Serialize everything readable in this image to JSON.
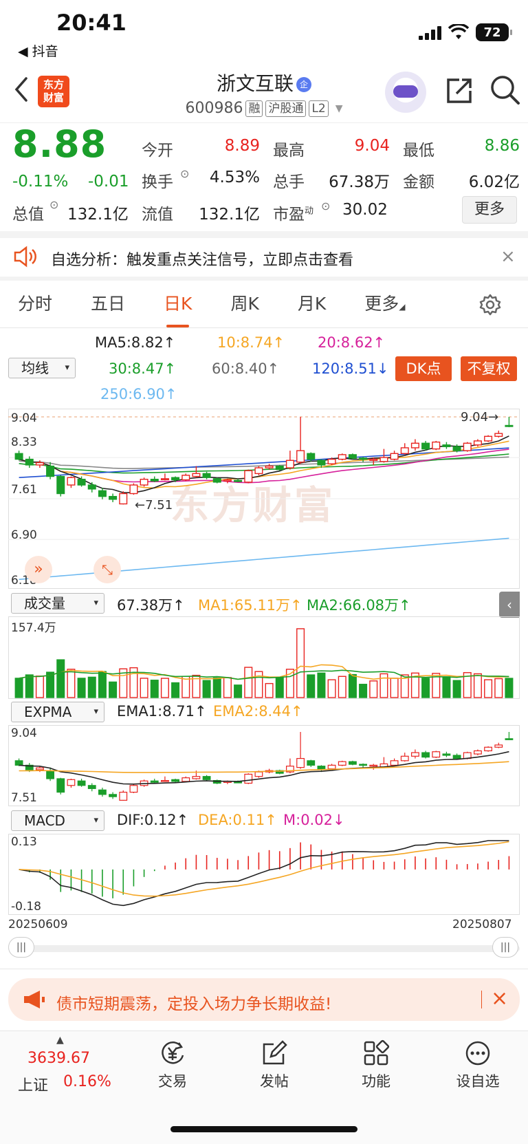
{
  "status_bar": {
    "time": "20:41",
    "back_app": "◀ 抖音",
    "battery": "72"
  },
  "header": {
    "logo_text": "东方\n财富",
    "stock_name": "浙文互联",
    "name_badge": "企",
    "stock_code": "600986",
    "tags": [
      "融",
      "沪股通",
      "L2"
    ]
  },
  "quote": {
    "price": "8.88",
    "change_pct": "-0.11%",
    "change_amt": "-0.01",
    "open_label": "今开",
    "open": "8.89",
    "high_label": "最高",
    "high": "9.04",
    "low_label": "最低",
    "low": "8.86",
    "turnover_label": "换手",
    "turnover": "4.53%",
    "volume_label": "总手",
    "volume": "67.38万",
    "amount_label": "金额",
    "amount": "6.02亿",
    "total_cap_label": "总值",
    "total_cap": "132.1亿",
    "float_cap_label": "流值",
    "float_cap": "132.1亿",
    "pe_label": "市盈",
    "pe_sup": "动",
    "pe": "30.02",
    "more_label": "更多"
  },
  "notice": {
    "text": "自选分析：触发重点关注信号，立即点击查看"
  },
  "tabs": [
    "分时",
    "五日",
    "日K",
    "周K",
    "月K",
    "更多"
  ],
  "active_tab": "日K",
  "kline": {
    "ma_selector": "均线",
    "ma5": "MA5:8.82↑",
    "ma10": "10:8.74↑",
    "ma20": "20:8.62↑",
    "ma30": "30:8.47↑",
    "ma60": "60:8.40↑",
    "ma120": "120:8.51↓",
    "ma250": "250:6.90↑",
    "dk_button": "DK点",
    "fq_button": "不复权",
    "y_labels": [
      "9.04",
      "8.33",
      "7.61",
      "6.90",
      "6.18"
    ],
    "max_marker": "9.04→",
    "min_marker": "←7.51",
    "watermark": "东方财富",
    "colors": {
      "up": "#e8231f",
      "down": "#1a9e2a",
      "ma5": "#222222",
      "ma10": "#f5a623",
      "ma20": "#d6219b",
      "ma30": "#1a9e2a",
      "ma60": "#888888",
      "ma120": "#1f4fd1",
      "ma250": "#6cb8f0"
    }
  },
  "volume": {
    "selector": "成交量",
    "value": "67.38万↑",
    "ma1": "MA1:65.11万↑",
    "ma2": "MA2:66.08万↑",
    "y_max": "157.4万"
  },
  "expma": {
    "selector": "EXPMA",
    "ema1": "EMA1:8.71↑",
    "ema2": "EMA2:8.44↑",
    "y_labels": [
      "9.04",
      "7.51"
    ]
  },
  "macd": {
    "selector": "MACD",
    "dif": "DIF:0.12↑",
    "dea": "DEA:0.11↑",
    "m": "M:0.02↓",
    "y_labels": [
      "0.13",
      "-0.18"
    ]
  },
  "date_range": {
    "start": "20250609",
    "end": "20250807"
  },
  "banner": {
    "text": "债市短期震荡，定投入场力争长期收益!"
  },
  "bottom_nav": {
    "index_value": "3639.67",
    "index_name": "上证",
    "index_change": "0.16%",
    "items": [
      "交易",
      "发帖",
      "功能",
      "设自选"
    ]
  },
  "chart_data": {
    "type": "candlestick",
    "title": "",
    "ylim": [
      6.18,
      9.04
    ],
    "candles": [
      {
        "o": 8.4,
        "c": 8.3,
        "h": 8.45,
        "l": 8.28
      },
      {
        "o": 8.3,
        "c": 8.2,
        "h": 8.35,
        "l": 8.15
      },
      {
        "o": 8.2,
        "c": 8.24,
        "h": 8.28,
        "l": 8.15
      },
      {
        "o": 8.18,
        "c": 8.0,
        "h": 8.25,
        "l": 7.95
      },
      {
        "o": 8.0,
        "c": 7.7,
        "h": 8.02,
        "l": 7.65
      },
      {
        "o": 7.85,
        "c": 7.98,
        "h": 8.0,
        "l": 7.8
      },
      {
        "o": 7.95,
        "c": 7.85,
        "h": 8.0,
        "l": 7.82
      },
      {
        "o": 7.85,
        "c": 7.78,
        "h": 7.9,
        "l": 7.72
      },
      {
        "o": 7.75,
        "c": 7.65,
        "h": 7.8,
        "l": 7.6
      },
      {
        "o": 7.65,
        "c": 7.6,
        "h": 7.7,
        "l": 7.55
      },
      {
        "o": 7.52,
        "c": 7.7,
        "h": 7.74,
        "l": 7.51
      },
      {
        "o": 7.7,
        "c": 7.85,
        "h": 7.88,
        "l": 7.68
      },
      {
        "o": 7.85,
        "c": 7.95,
        "h": 7.98,
        "l": 7.82
      },
      {
        "o": 7.95,
        "c": 7.92,
        "h": 8.0,
        "l": 7.9
      },
      {
        "o": 7.95,
        "c": 7.96,
        "h": 8.05,
        "l": 7.93
      },
      {
        "o": 7.98,
        "c": 7.94,
        "h": 8.0,
        "l": 7.9
      },
      {
        "o": 7.94,
        "c": 8.02,
        "h": 8.05,
        "l": 7.92
      },
      {
        "o": 8.0,
        "c": 8.05,
        "h": 8.18,
        "l": 7.98
      },
      {
        "o": 8.05,
        "c": 7.98,
        "h": 8.08,
        "l": 7.95
      },
      {
        "o": 7.96,
        "c": 7.9,
        "h": 7.98,
        "l": 7.88
      },
      {
        "o": 7.92,
        "c": 7.94,
        "h": 7.96,
        "l": 7.88
      },
      {
        "o": 7.93,
        "c": 7.92,
        "h": 7.96,
        "l": 7.9
      },
      {
        "o": 7.9,
        "c": 8.1,
        "h": 8.12,
        "l": 7.88
      },
      {
        "o": 8.05,
        "c": 8.15,
        "h": 8.18,
        "l": 8.02
      },
      {
        "o": 8.15,
        "c": 8.18,
        "h": 8.22,
        "l": 8.12
      },
      {
        "o": 8.18,
        "c": 8.12,
        "h": 8.2,
        "l": 8.1
      },
      {
        "o": 8.15,
        "c": 8.28,
        "h": 8.45,
        "l": 8.12
      },
      {
        "o": 8.25,
        "c": 8.45,
        "h": 9.04,
        "l": 8.22
      },
      {
        "o": 8.4,
        "c": 8.3,
        "h": 8.42,
        "l": 8.26
      },
      {
        "o": 8.28,
        "c": 8.2,
        "h": 8.3,
        "l": 8.15
      },
      {
        "o": 8.22,
        "c": 8.3,
        "h": 8.33,
        "l": 8.2
      },
      {
        "o": 8.3,
        "c": 8.38,
        "h": 8.4,
        "l": 8.28
      },
      {
        "o": 8.38,
        "c": 8.32,
        "h": 8.4,
        "l": 8.3
      },
      {
        "o": 8.32,
        "c": 8.3,
        "h": 8.34,
        "l": 8.25
      },
      {
        "o": 8.28,
        "c": 8.3,
        "h": 8.33,
        "l": 8.2
      },
      {
        "o": 8.26,
        "c": 8.33,
        "h": 8.48,
        "l": 8.24
      },
      {
        "o": 8.3,
        "c": 8.4,
        "h": 8.45,
        "l": 8.28
      },
      {
        "o": 8.4,
        "c": 8.5,
        "h": 8.58,
        "l": 8.38
      },
      {
        "o": 8.5,
        "c": 8.58,
        "h": 8.65,
        "l": 8.45
      },
      {
        "o": 8.58,
        "c": 8.48,
        "h": 8.62,
        "l": 8.45
      },
      {
        "o": 8.48,
        "c": 8.6,
        "h": 8.62,
        "l": 8.46
      },
      {
        "o": 8.55,
        "c": 8.52,
        "h": 8.6,
        "l": 8.48
      },
      {
        "o": 8.52,
        "c": 8.45,
        "h": 8.56,
        "l": 8.42
      },
      {
        "o": 8.45,
        "c": 8.58,
        "h": 8.6,
        "l": 8.43
      },
      {
        "o": 8.55,
        "c": 8.62,
        "h": 8.65,
        "l": 8.52
      },
      {
        "o": 8.62,
        "c": 8.7,
        "h": 8.72,
        "l": 8.6
      },
      {
        "o": 8.7,
        "c": 8.75,
        "h": 8.8,
        "l": 8.68
      },
      {
        "o": 8.89,
        "c": 8.88,
        "h": 9.04,
        "l": 8.86
      }
    ]
  }
}
